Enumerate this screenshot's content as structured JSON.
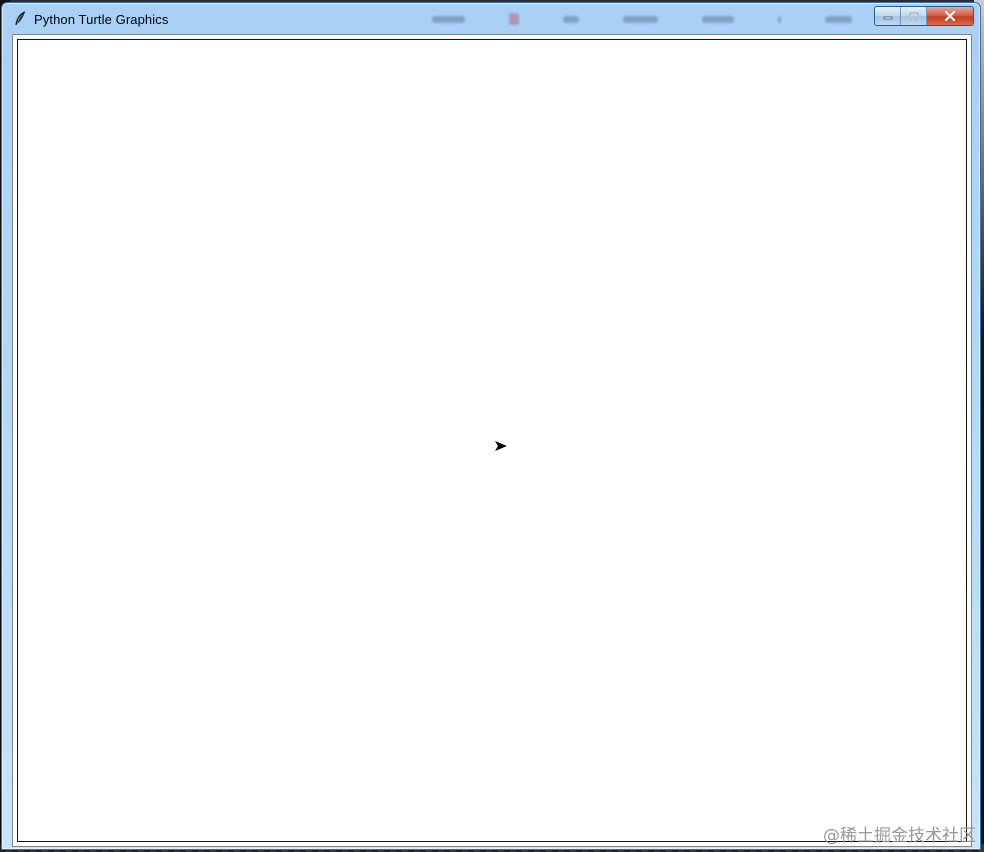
{
  "window": {
    "title": "Python Turtle Graphics",
    "app_icon": "feather-icon",
    "controls": {
      "minimize_icon": "minimize-icon",
      "maximize_icon": "maximize-icon",
      "close_icon": "close-icon"
    }
  },
  "canvas": {
    "background": "#ffffff",
    "turtle": {
      "shape": "arrow",
      "heading": "east",
      "color": "#000000"
    }
  },
  "watermark": {
    "text": "@稀土掘金技术社区"
  },
  "colors": {
    "titlebar": "#b7dbf7",
    "close_button": "#c23c22"
  }
}
